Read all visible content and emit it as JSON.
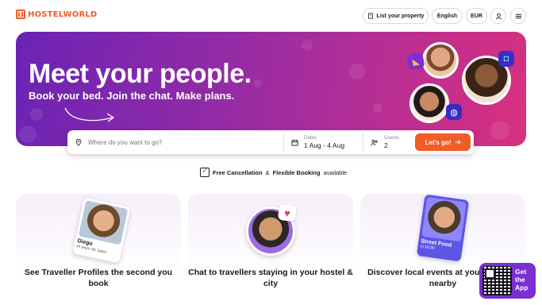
{
  "header": {
    "logo": "HOSTELWORLD",
    "list_property": "List your property",
    "language": "English",
    "currency": "EUR"
  },
  "hero": {
    "title": "Meet your people.",
    "subtitle": "Book your bed. Join the chat. Make plans."
  },
  "search": {
    "where_placeholder": "Where do you want to go?",
    "dates_label": "Dates",
    "dates_value": "1 Aug - 4 Aug",
    "guests_label": "Guests",
    "guests_value": "2",
    "go_label": "Let's go!"
  },
  "policy": {
    "free_cancellation": "Free Cancellation",
    "amp": "&",
    "flexible_booking": "Flexible Booking",
    "available": "available"
  },
  "features": [
    {
      "text": "See Traveller Profiles the second you book",
      "profile_name": "Diego",
      "profile_meta": "24 years old, Spain"
    },
    {
      "text": "Chat to travellers staying in your hostel & city"
    },
    {
      "text": "Discover local events at your hostel & nearby",
      "event_name": "Street Food",
      "event_time": "18:30"
    }
  ],
  "app_promo": {
    "label": "Get the App"
  },
  "colors": {
    "brand_orange": "#f25c27",
    "hero_purple": "#6b23b5",
    "hero_pink": "#d8307f"
  }
}
